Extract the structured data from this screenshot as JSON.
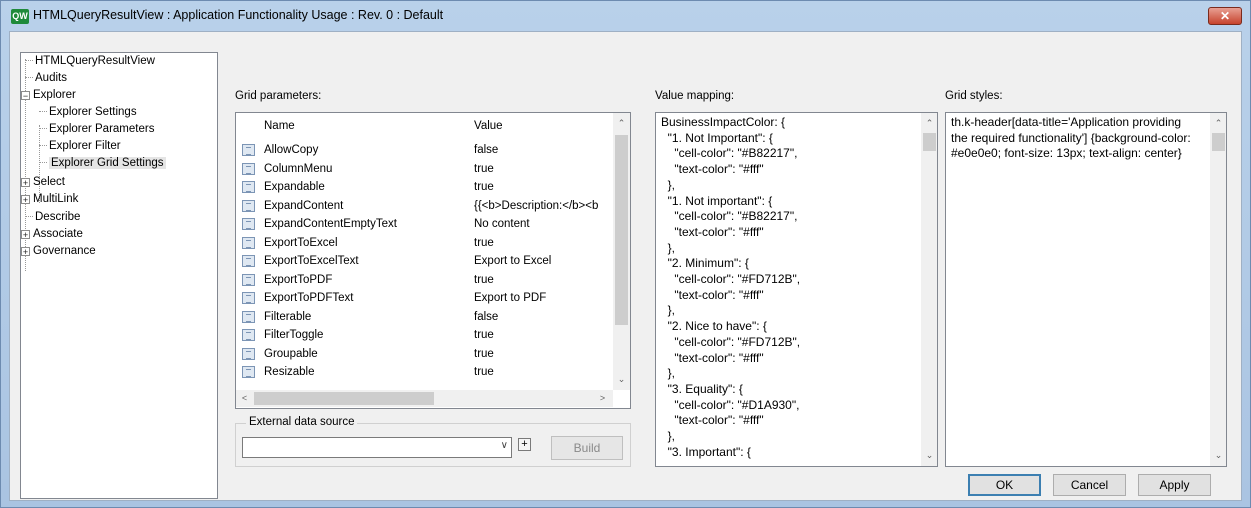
{
  "window": {
    "app_icon_text": "QW",
    "title": "HTMLQueryResultView : Application Functionality Usage : Rev. 0  : Default",
    "close_label": "✕"
  },
  "tree": {
    "items": [
      {
        "label": "HTMLQueryResultView"
      },
      {
        "label": "Audits"
      },
      {
        "label": "Explorer"
      },
      {
        "label": "Explorer Settings"
      },
      {
        "label": "Explorer Parameters"
      },
      {
        "label": "Explorer Filter"
      },
      {
        "label": "Explorer Grid Settings"
      },
      {
        "label": "Select"
      },
      {
        "label": "MultiLink"
      },
      {
        "label": "Describe"
      },
      {
        "label": "Associate"
      },
      {
        "label": "Governance"
      }
    ],
    "expanded_glyph": "−",
    "collapsed_glyph": "+"
  },
  "grid_params": {
    "label": "Grid parameters:",
    "col_name": "Name",
    "col_value": "Value",
    "rows": [
      {
        "name": "AllowCopy",
        "value": "false"
      },
      {
        "name": "ColumnMenu",
        "value": "true"
      },
      {
        "name": "Expandable",
        "value": "true"
      },
      {
        "name": "ExpandContent",
        "value": "{{<b>Description:</b><b"
      },
      {
        "name": "ExpandContentEmptyText",
        "value": "No content"
      },
      {
        "name": "ExportToExcel",
        "value": "true"
      },
      {
        "name": "ExportToExcelText",
        "value": "Export to Excel"
      },
      {
        "name": "ExportToPDF",
        "value": "true"
      },
      {
        "name": "ExportToPDFText",
        "value": "Export to PDF"
      },
      {
        "name": "Filterable",
        "value": "false"
      },
      {
        "name": "FilterToggle",
        "value": "true"
      },
      {
        "name": "Groupable",
        "value": "true"
      },
      {
        "name": "Resizable",
        "value": "true"
      }
    ]
  },
  "external": {
    "legend": "External data source",
    "combo_value": "",
    "plus_label": "+",
    "build_label": "Build"
  },
  "value_mapping": {
    "label": "Value mapping:",
    "text": "BusinessImpactColor: {\n  \"1. Not Important\": {\n    \"cell-color\": \"#B82217\",\n    \"text-color\": \"#fff\"\n  },\n  \"1. Not important\": {\n    \"cell-color\": \"#B82217\",\n    \"text-color\": \"#fff\"\n  },\n  \"2. Minimum\": {\n    \"cell-color\": \"#FD712B\",\n    \"text-color\": \"#fff\"\n  },\n  \"2. Nice to have\": {\n    \"cell-color\": \"#FD712B\",\n    \"text-color\": \"#fff\"\n  },\n  \"3. Equality\": {\n    \"cell-color\": \"#D1A930\",\n    \"text-color\": \"#fff\"\n  },\n  \"3. Important\": {"
  },
  "grid_styles": {
    "label": "Grid styles:",
    "text": "th.k-header[data-title='Application providing the required functionality'] {background-color: #e0e0e0; font-size: 13px; text-align: center}"
  },
  "buttons": {
    "ok": "OK",
    "cancel": "Cancel",
    "apply": "Apply"
  },
  "scroll_glyphs": {
    "up": "⌃",
    "down": "⌄",
    "left": "<",
    "right": ">"
  }
}
